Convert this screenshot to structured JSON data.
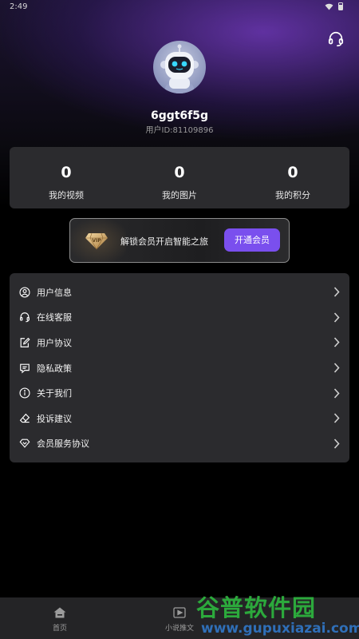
{
  "status_bar": {
    "time": "2:49"
  },
  "user": {
    "name": "6ggt6f5g",
    "id_text": "用户ID:81109896"
  },
  "stats": [
    {
      "value": "0",
      "label": "我的视频"
    },
    {
      "value": "0",
      "label": "我的图片"
    },
    {
      "value": "0",
      "label": "我的积分"
    }
  ],
  "vip": {
    "badge": "VIP",
    "text": "解锁会员开启智能之旅",
    "button": "开通会员"
  },
  "menu": [
    {
      "label": "用户信息",
      "icon": "user-circle-icon"
    },
    {
      "label": "在线客服",
      "icon": "headset-icon"
    },
    {
      "label": "用户协议",
      "icon": "edit-document-icon"
    },
    {
      "label": "隐私政策",
      "icon": "message-icon"
    },
    {
      "label": "关于我们",
      "icon": "info-icon"
    },
    {
      "label": "投诉建议",
      "icon": "eraser-icon"
    },
    {
      "label": "会员服务协议",
      "icon": "heart-diamond-icon"
    }
  ],
  "tabs": [
    {
      "label": "首页",
      "icon": "home-icon"
    },
    {
      "label": "小说推文",
      "icon": "video-icon"
    },
    {
      "label": "",
      "icon": ""
    }
  ],
  "watermark": {
    "text": "谷普软件园",
    "url": "www.gupuxiazai.com"
  },
  "colors": {
    "accent": "#7a4fee",
    "card": "#2b2b2e",
    "tabbar": "#242426",
    "watermark_green": "#2ca93c",
    "watermark_blue": "#2f6fb8"
  }
}
